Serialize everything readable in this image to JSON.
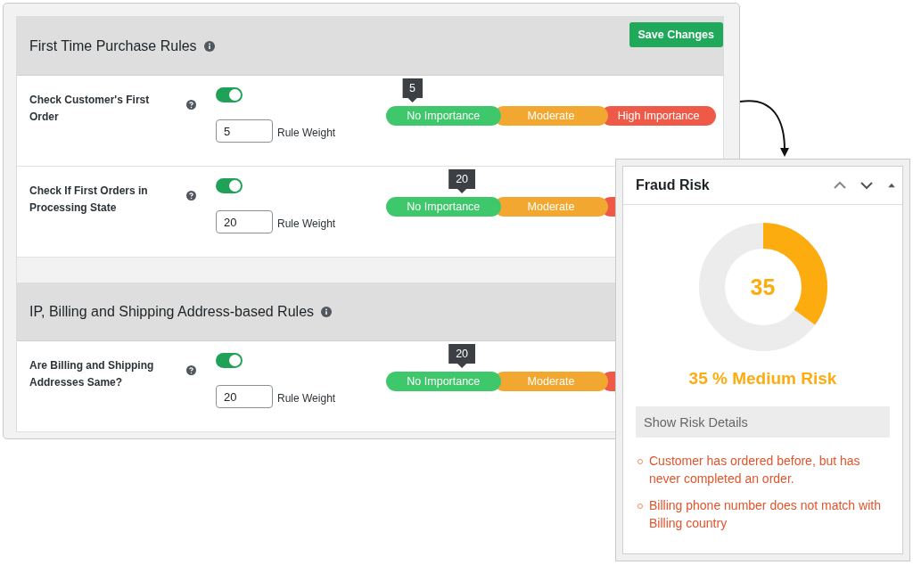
{
  "save_button": {
    "label": "Save Changes"
  },
  "sections": [
    {
      "title": "First Time Purchase Rules",
      "rules": [
        {
          "label": "Check Customer's First Order",
          "on": true,
          "weight": "5",
          "weight_label": "Rule Weight",
          "slider": {
            "level": 0.08,
            "value": "5",
            "segments": [
              {
                "kind": "low",
                "label": "No Importance"
              },
              {
                "kind": "mid",
                "label": "Moderate"
              },
              {
                "kind": "high",
                "label": "High Importance"
              }
            ]
          }
        },
        {
          "label": "Check If First Orders in Processing State",
          "on": true,
          "weight": "20",
          "weight_label": "Rule Weight",
          "slider": {
            "level": 0.23,
            "value": "20",
            "segments": [
              {
                "kind": "low",
                "label": "No Importance"
              },
              {
                "kind": "mid",
                "label": "Moderate"
              },
              {
                "kind": "high"
              }
            ]
          }
        }
      ]
    },
    {
      "title": "IP, Billing and Shipping Address-based Rules",
      "rules": [
        {
          "label": "Are Billing and Shipping Addresses Same?",
          "on": true,
          "weight": "20",
          "weight_label": "Rule Weight",
          "slider": {
            "level": 0.23,
            "value": "20",
            "segments": [
              {
                "kind": "low",
                "label": "No Importance"
              },
              {
                "kind": "mid",
                "label": "Moderate"
              },
              {
                "kind": "high"
              }
            ]
          }
        }
      ]
    }
  ],
  "fraud_risk": {
    "title": "Fraud Risk",
    "gauge": {
      "level": 0.35,
      "value": "35"
    },
    "risk_label": "35 % Medium Risk",
    "details_button": "Show Risk Details",
    "reasons": [
      "Customer has ordered before, but has never completed an order.",
      "Billing phone number does not match with Billing country"
    ]
  }
}
